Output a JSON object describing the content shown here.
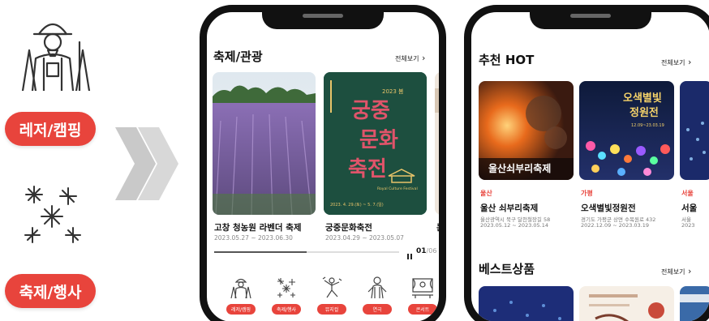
{
  "legend": [
    {
      "label": "레저/캠핑",
      "icon": "hiker-icon"
    },
    {
      "label": "축제/행사",
      "icon": "fireworks-icon"
    }
  ],
  "phone1": {
    "section_title": "축제/관광",
    "more_label": "전체보기",
    "cards": [
      {
        "title": "고창 청농원 라벤더 축제",
        "date": "2023.05.27 ~ 2023.06.30"
      },
      {
        "title": "궁중문화축전",
        "date": "2023.04.29 ~ 2023.05.07"
      },
      {
        "title": "논"
      }
    ],
    "poster": {
      "title": "궁중문화축전",
      "subtitle": "Royal Culture Festival",
      "date": "2023. 4. 29.(토) ~ 5. 7.(일)",
      "year": "2023 봄"
    },
    "pager": {
      "current": "01",
      "total": "/06",
      "progress": 0.5
    },
    "categories": [
      {
        "label": "레저/캠핑",
        "icon": "hiker-icon"
      },
      {
        "label": "축제/행사",
        "icon": "fireworks-icon"
      },
      {
        "label": "뮤지컬",
        "icon": "dancer-icon"
      },
      {
        "label": "연극",
        "icon": "theater-icon"
      },
      {
        "label": "콘서트",
        "icon": "concert-icon"
      }
    ]
  },
  "phone2": {
    "section_title": "추천 HOT",
    "more_label": "전체보기",
    "cards": [
      {
        "region": "울산",
        "title": "울산 쇠부리축제",
        "address": "울산광역시 북구 달천철장길 58",
        "date": "2023.05.12 ~ 2023.05.14",
        "overlay": "울산쇠부리축제"
      },
      {
        "region": "가평",
        "title": "오색별빛정원전",
        "address": "경기도 가평군 상면 수목원로 432",
        "date": "2022.12.09 ~ 2023.03.19",
        "overlay_line1": "오색별빛",
        "overlay_line2": "정원전",
        "overlay_info": "12.09~23.03.19"
      },
      {
        "region": "서울",
        "title": "서울",
        "address": "서울",
        "date": "2023"
      }
    ],
    "best_title": "베스트상품",
    "best_more_label": "전체보기"
  },
  "colors": {
    "accent": "#e8443c",
    "poster_bg": "#1d4f3f",
    "poster_text": "#e0546a"
  }
}
